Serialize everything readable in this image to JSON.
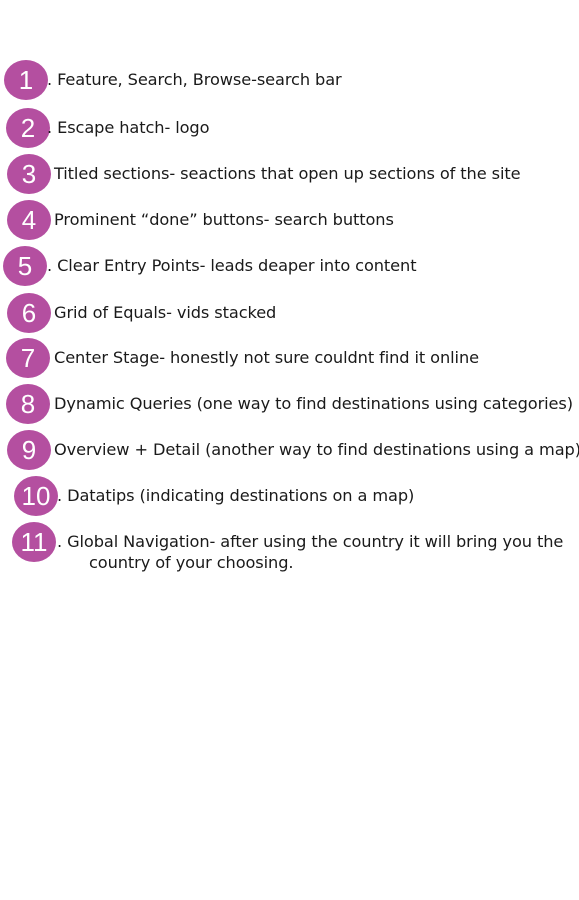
{
  "theme": {
    "badge_color": "#b44fa0",
    "text_color": "#1a1a1a",
    "background": "#ffffff"
  },
  "items": [
    {
      "number": "1",
      "text": ". Feature, Search, Browse-search bar"
    },
    {
      "number": "2",
      "text": ". Escape hatch- logo"
    },
    {
      "number": "3",
      "text": "Titled sections- seactions that open up sections of the site"
    },
    {
      "number": "4",
      "text": "Prominent “done” buttons- search buttons"
    },
    {
      "number": "5",
      "text": ". Clear Entry Points- leads deaper into content"
    },
    {
      "number": "6",
      "text": "Grid of Equals- vids stacked"
    },
    {
      "number": "7",
      "text": "Center Stage- honestly not sure couldnt find it online"
    },
    {
      "number": "8",
      "text": "Dynamic Queries (one way to find destinations using categories)"
    },
    {
      "number": "9",
      "text": "Overview + Detail (another way to find destinations using a map)"
    },
    {
      "number": "10",
      "text": ". Datatips (indicating destinations on a map)"
    },
    {
      "number": "11",
      "text": ". Global Navigation- after using the country it will bring you the",
      "text_cont": "country of your choosing."
    }
  ]
}
